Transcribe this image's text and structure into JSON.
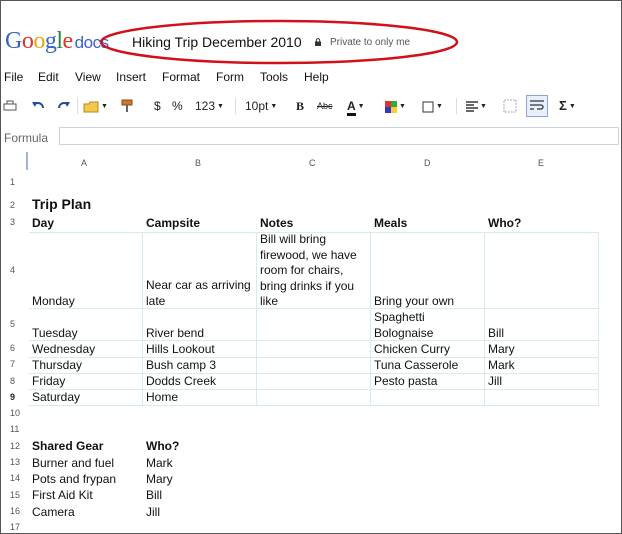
{
  "app": {
    "logo_letters": [
      "G",
      "o",
      "o",
      "g",
      "l",
      "e"
    ],
    "logo_suffix": "docs",
    "document_title": "Hiking Trip December 2010",
    "privacy_status": "Private to only me",
    "highlight_color": "#d0111a"
  },
  "menu": [
    "File",
    "Edit",
    "View",
    "Insert",
    "Format",
    "Form",
    "Tools",
    "Help"
  ],
  "toolbar": {
    "currency": "$",
    "percent": "%",
    "number_format": "123",
    "font_size": "10pt",
    "bold": "B",
    "strikethrough": "Abc",
    "text_color": "A",
    "sum": "Σ"
  },
  "formula": {
    "label": "Formula",
    "value": ""
  },
  "sheet": {
    "columns": [
      "A",
      "B",
      "C",
      "D",
      "E"
    ],
    "rows": [
      "1",
      "2",
      "3",
      "4",
      "5",
      "6",
      "7",
      "8",
      "9",
      "10",
      "11",
      "12",
      "13",
      "14",
      "15",
      "16",
      "17"
    ],
    "title": "Trip Plan",
    "headers": [
      "Day",
      "Campsite",
      "Notes",
      "Meals",
      "Who?"
    ],
    "plan_rows": [
      {
        "day": "Monday",
        "campsite": "Near car as arriving late",
        "notes": "Bill will bring firewood, we have room for chairs, bring drinks if you like",
        "meals": "Bring your own",
        "who": ""
      },
      {
        "day": "Tuesday",
        "campsite": "River bend",
        "notes": "",
        "meals": "Spaghetti Bolognaise",
        "who": "Bill"
      },
      {
        "day": "Wednesday",
        "campsite": "Hills Lookout",
        "notes": "",
        "meals": "Chicken Curry",
        "who": "Mary"
      },
      {
        "day": "Thursday",
        "campsite": "Bush camp 3",
        "notes": "",
        "meals": "Tuna Casserole",
        "who": "Mark"
      },
      {
        "day": "Friday",
        "campsite": "Dodds Creek",
        "notes": "",
        "meals": "Pesto pasta",
        "who": "Jill"
      },
      {
        "day": "Saturday",
        "campsite": "Home",
        "notes": "",
        "meals": "",
        "who": ""
      }
    ],
    "gear_headers": [
      "Shared Gear",
      "Who?"
    ],
    "gear": [
      {
        "item": "Burner and fuel",
        "who": "Mark"
      },
      {
        "item": "Pots and frypan",
        "who": "Mary"
      },
      {
        "item": "First Aid Kit",
        "who": "Bill"
      },
      {
        "item": "Camera",
        "who": "Jill"
      }
    ]
  }
}
